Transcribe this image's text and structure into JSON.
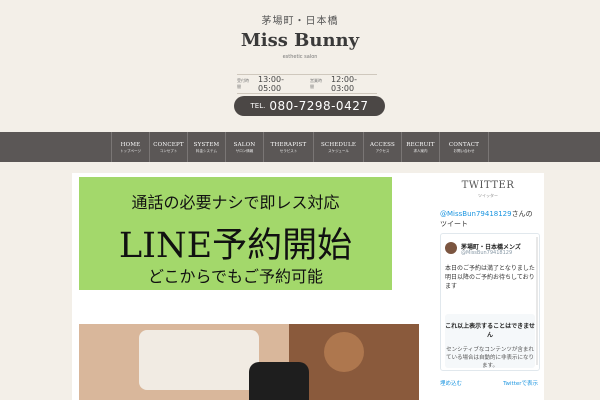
{
  "header": {
    "area": "茅場町・日本橋",
    "logo": "Miss Bunny",
    "logo_sub": "esthetic salon",
    "hours": [
      {
        "label": "受付時間",
        "value": "13:00-05:00"
      },
      {
        "label": "営業時間",
        "value": "12:00-03:00"
      }
    ],
    "tel_label": "TEL.",
    "tel_number": "080-7298-0427"
  },
  "nav": [
    {
      "en": "HOME",
      "ja": "トップページ"
    },
    {
      "en": "CONCEPT",
      "ja": "コンセプト"
    },
    {
      "en": "SYSTEM",
      "ja": "料金システム"
    },
    {
      "en": "SALON",
      "ja": "サロン情報"
    },
    {
      "en": "THERAPIST",
      "ja": "セラピスト"
    },
    {
      "en": "SCHEDULE",
      "ja": "スケジュール"
    },
    {
      "en": "ACCESS",
      "ja": "アクセス"
    },
    {
      "en": "RECRUIT",
      "ja": "求人案内"
    },
    {
      "en": "CONTACT",
      "ja": "お問い合わせ"
    }
  ],
  "banner": {
    "line1": "通話の必要ナシで即レス対応",
    "line2": "LINE予約開始",
    "line3": "どこからでもご予約可能",
    "bg_color": "#a3d86b"
  },
  "sidebar": {
    "title": "TWITTER",
    "subtitle": "ツイッター",
    "header_handle": "@MissBun79418129",
    "header_suffix": "さんのツイート",
    "tweet": {
      "name": "茅場町・日本橋メンズ",
      "handle": "@MissBun79418129",
      "text": "本日のご予約は満了となりました 明日以降のご予約お待ちしております",
      "sensitive_title": "これ以上表示することはできません",
      "sensitive_body": "センシティブなコンテンツが含まれている場合は自動的に非表示になります。"
    },
    "footer_embed": "埋め込む",
    "footer_view": "Twitterで表示"
  }
}
